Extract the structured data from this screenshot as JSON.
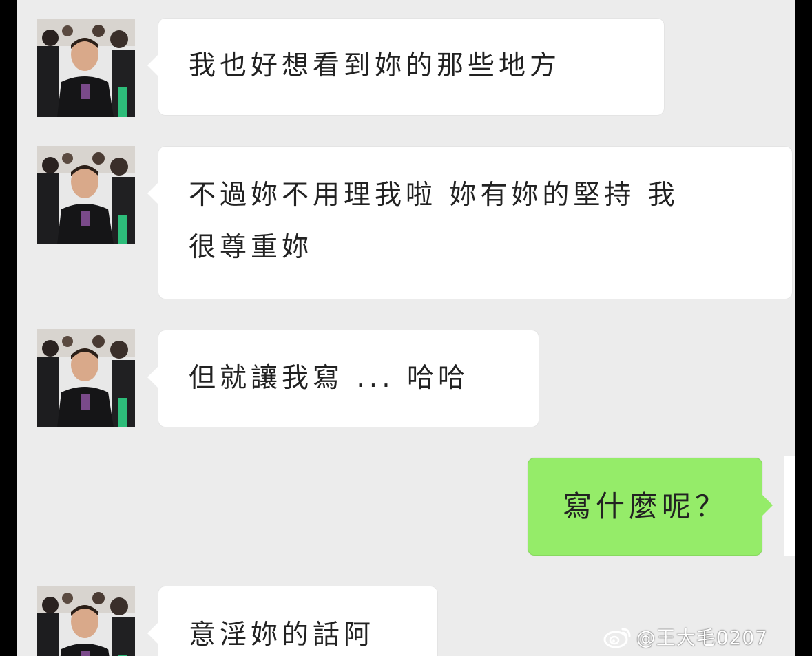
{
  "messages": [
    {
      "side": "left",
      "text": "我也好想看到妳的那些地方"
    },
    {
      "side": "left",
      "text": "不過妳不用理我啦 妳有妳的堅持 我\n很尊重妳"
    },
    {
      "side": "left",
      "text": "但就讓我寫 ... 哈哈"
    },
    {
      "side": "right",
      "text": "寫什麼呢？"
    },
    {
      "side": "left",
      "text": "意淫妳的話阿"
    }
  ],
  "watermark": {
    "text": "@王大毛0207",
    "icon": "weibo-logo-icon"
  },
  "colors": {
    "background": "#ececec",
    "incoming_bubble": "#ffffff",
    "outgoing_bubble": "#95ec69",
    "text": "#222222"
  }
}
